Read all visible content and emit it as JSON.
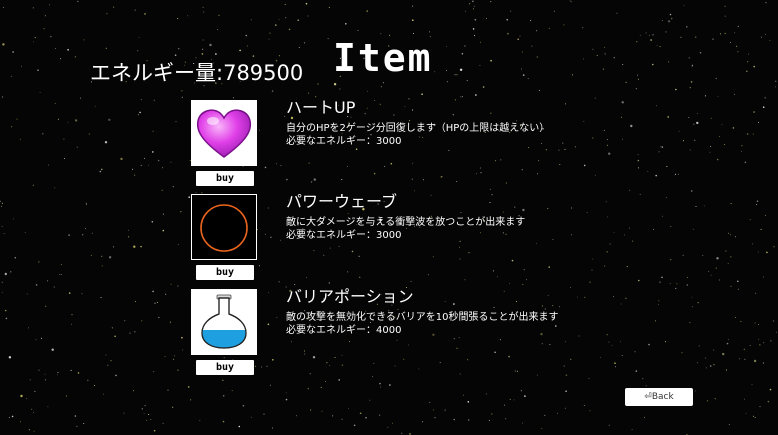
{
  "header": {
    "energy_label": "エネルギー量:",
    "energy_value": "789500",
    "title": "Item"
  },
  "items": [
    {
      "name": "ハートUP",
      "description": "自分のHPを2ゲージ分回復します（HPの上限は越えない）",
      "cost_label": "必要なエネルギー：",
      "cost": "3000",
      "buy_label": "buy",
      "icon": "heart-icon",
      "colors": {
        "icon_fill": "#e040e8",
        "icon_border": "#ffffff"
      }
    },
    {
      "name": "パワーウェーブ",
      "description": "敵に大ダメージを与える衝撃波を放つことが出来ます",
      "cost_label": "必要なエネルギー：",
      "cost": "3000",
      "buy_label": "buy",
      "icon": "power-wave-ring-icon",
      "colors": {
        "icon_fill": "#e8641e",
        "icon_border": "#000000"
      }
    },
    {
      "name": "バリアポーション",
      "description": "敵の攻撃を無効化できるバリアを10秒間張ることが出来ます",
      "cost_label": "必要なエネルギー：",
      "cost": "4000",
      "buy_label": "buy",
      "icon": "potion-flask-icon",
      "colors": {
        "icon_fill": "#1e9fe0",
        "icon_border": "#ffffff"
      }
    }
  ],
  "back": {
    "label": "⏎Back"
  },
  "colors": {
    "background": "#050505",
    "stars": "#e8e89a",
    "text": "#ffffff"
  }
}
